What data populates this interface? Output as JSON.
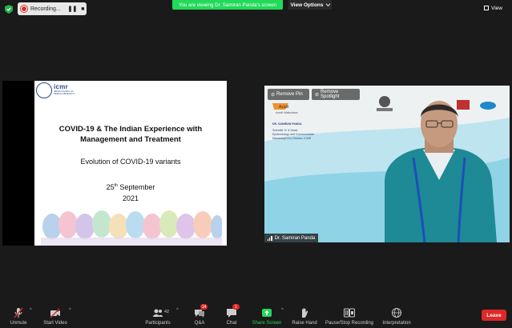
{
  "top": {
    "recording_label": "Recording...",
    "pause_glyph": "❚❚",
    "stop_glyph": "■",
    "screen_banner": "You are viewing Dr. Samiran Panda's screen",
    "view_options": "View Options",
    "view": "View"
  },
  "slide": {
    "logo_text": "icmr",
    "logo_sub": "INDIAN COUNCIL OF MEDICAL RESEARCH",
    "title_line1": "COVID-19 & The Indian Experience with",
    "title_line2": "Management and Treatment",
    "subtitle": "Evolution of COVID-19 variants",
    "date_day": "25",
    "date_sup": "th",
    "date_month": "September",
    "date_year": "2021"
  },
  "video": {
    "remove_pin": "Remove Pin",
    "remove_spotlight": "Remove Spotlight",
    "participant_name": "Dr. Samiran Panda",
    "azadi_text": "Azadi",
    "amrit_text": "Amrit Mahotsav",
    "bg_name": "DR. SAMIRAN PANDA",
    "bg_role1": "Scientist 'G' & Head,",
    "bg_role2": "Epidemiology and Communicable",
    "bg_role3": "Diseases(ECD) Division, ICMR"
  },
  "toolbar": {
    "unmute": "Unmute",
    "start_video": "Start Video",
    "participants": "Participants",
    "participants_count": "42",
    "qa": "Q&A",
    "qa_badge": "14",
    "chat": "Chat",
    "chat_badge": "1",
    "share_screen": "Share Screen",
    "raise_hand": "Raise Hand",
    "pause_recording": "Pause/Stop Recording",
    "interpretation": "Interpretation",
    "leave": "Leave"
  },
  "colors": {
    "banner_green": "#23d959",
    "leave_red": "#e02828",
    "icmr_blue": "#2c4a8a"
  }
}
